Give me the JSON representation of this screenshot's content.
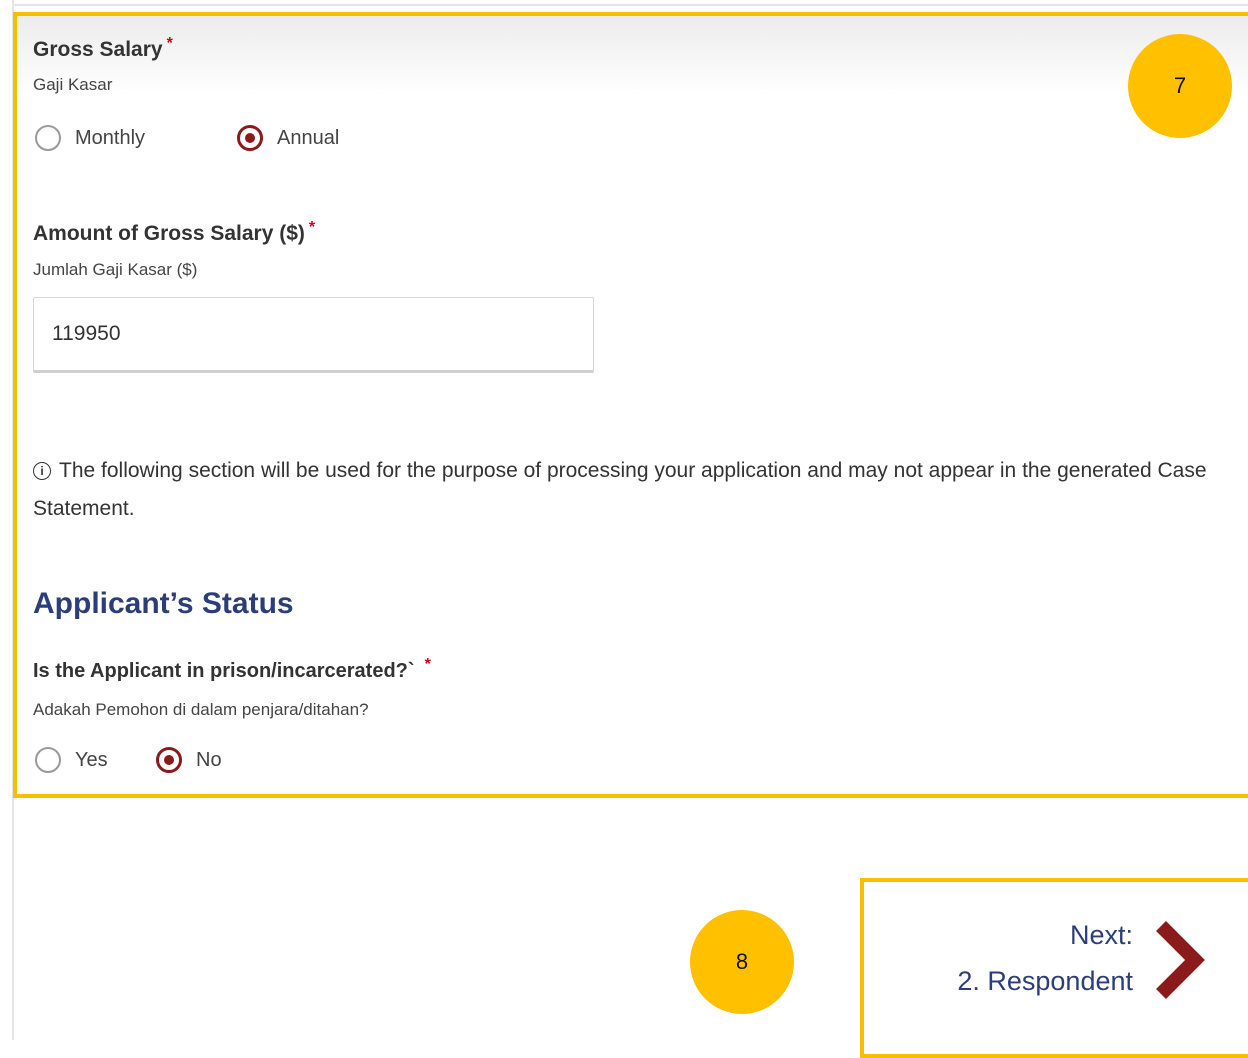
{
  "gross_salary": {
    "label": "Gross Salary",
    "sublabel": "Gaji Kasar",
    "required_mark": "*",
    "options": [
      {
        "label": "Monthly",
        "checked": false
      },
      {
        "label": "Annual",
        "checked": true
      }
    ]
  },
  "amount": {
    "label": "Amount of Gross Salary ($)",
    "sublabel": "Jumlah Gaji Kasar ($)",
    "required_mark": "*",
    "value": "119950"
  },
  "info": {
    "icon": "info-icon",
    "text": "The following section will be used for the purpose of processing your application and may not appear in the generated Case Statement."
  },
  "applicant_status": {
    "title": "Applicant’s Status",
    "question": "Is the Applicant in prison/incarcerated?`",
    "question_sub": "Adakah Pemohon di dalam penjara/ditahan?",
    "required_mark": "*",
    "options": [
      {
        "label": "Yes",
        "checked": false
      },
      {
        "label": "No",
        "checked": true
      }
    ]
  },
  "navigation": {
    "next_prefix": "Next:",
    "next_label": "2. Respondent",
    "icon": "chevron-right-icon"
  },
  "callouts": [
    "7",
    "8"
  ],
  "colors": {
    "accent": "#8b1a1a",
    "heading": "#2c3e7a",
    "highlight": "#f5c000",
    "callout": "#ffc000",
    "required": "#d0021b"
  }
}
